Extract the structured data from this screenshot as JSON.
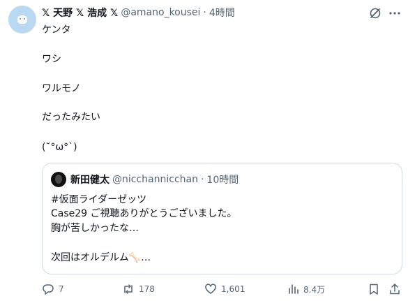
{
  "author": {
    "display_name": "𝕏 天野 𝕏 浩成 𝕏",
    "handle": "@amano_kousei",
    "separator": "·",
    "time": "4時間"
  },
  "body_lines": [
    "ケンタ",
    "ワシ",
    "ワルモノ",
    "だったみたい",
    "(˘°ω°`)"
  ],
  "quote": {
    "display_name": "新田健太",
    "handle": "@nicchannicchan",
    "separator": "·",
    "time": "10時間",
    "lines": [
      "#仮面ライダーゼッツ",
      "Case29 ご視聴ありがとうございました。",
      "胸が苦しかったな…",
      "次回はオルデルム🦴…"
    ]
  },
  "actions": {
    "replies": "7",
    "reposts": "178",
    "likes": "1,601",
    "views": "8.4万"
  },
  "icons": [
    "grok-icon",
    "more-icon",
    "reply-icon",
    "repost-icon",
    "like-icon",
    "views-icon",
    "bookmark-icon",
    "share-icon"
  ],
  "colors": {
    "text": "#0f1419",
    "secondary": "#536471",
    "border": "#cfd9de",
    "avatar_bg": "#b9d8f2"
  }
}
